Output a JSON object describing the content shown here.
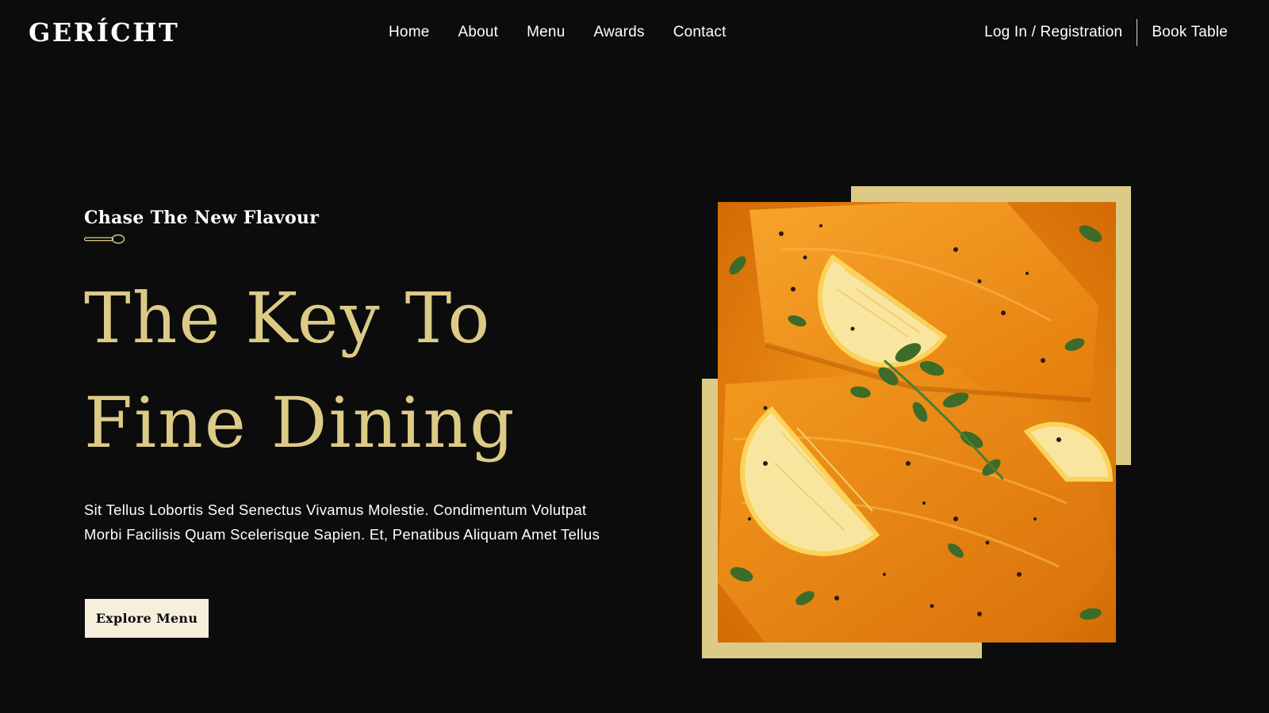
{
  "brand": {
    "logo": "GERÍCHT"
  },
  "nav": {
    "links": [
      "Home",
      "About",
      "Menu",
      "Awards",
      "Contact"
    ],
    "login": "Log In / Registration",
    "book": "Book Table"
  },
  "hero": {
    "subtitle": "Chase The New Flavour",
    "headline_line1": "The Key To",
    "headline_line2": "Fine Dining",
    "description": "Sit Tellus Lobortis Sed Senectus Vivamus Molestie. Condimentum Volutpat Morbi Facilisis Quam Scelerisque Sapien. Et, Penatibus Aliquam Amet Tellus",
    "button": "Explore Menu"
  },
  "colors": {
    "background": "#0c0c0c",
    "accent_gold": "#dcca87",
    "button_bg": "#f6efdc",
    "text": "#ffffff"
  },
  "icons": [
    "spoon-icon"
  ]
}
